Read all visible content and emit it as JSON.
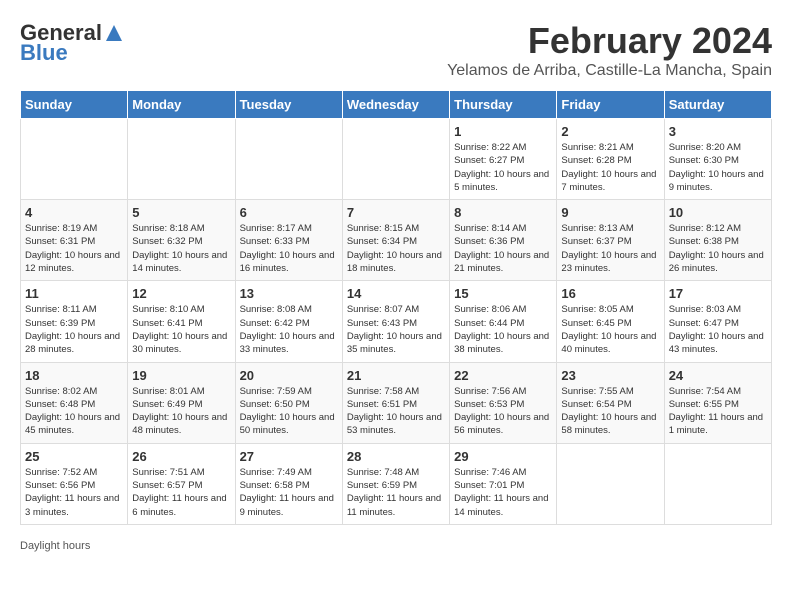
{
  "header": {
    "logo_general": "General",
    "logo_blue": "Blue",
    "month_title": "February 2024",
    "location": "Yelamos de Arriba, Castille-La Mancha, Spain"
  },
  "days_of_week": [
    "Sunday",
    "Monday",
    "Tuesday",
    "Wednesday",
    "Thursday",
    "Friday",
    "Saturday"
  ],
  "footer": {
    "daylight_hours": "Daylight hours"
  },
  "weeks": [
    {
      "days": [
        {
          "number": "",
          "info": ""
        },
        {
          "number": "",
          "info": ""
        },
        {
          "number": "",
          "info": ""
        },
        {
          "number": "",
          "info": ""
        },
        {
          "number": "1",
          "info": "Sunrise: 8:22 AM\nSunset: 6:27 PM\nDaylight: 10 hours and 5 minutes."
        },
        {
          "number": "2",
          "info": "Sunrise: 8:21 AM\nSunset: 6:28 PM\nDaylight: 10 hours and 7 minutes."
        },
        {
          "number": "3",
          "info": "Sunrise: 8:20 AM\nSunset: 6:30 PM\nDaylight: 10 hours and 9 minutes."
        }
      ]
    },
    {
      "days": [
        {
          "number": "4",
          "info": "Sunrise: 8:19 AM\nSunset: 6:31 PM\nDaylight: 10 hours and 12 minutes."
        },
        {
          "number": "5",
          "info": "Sunrise: 8:18 AM\nSunset: 6:32 PM\nDaylight: 10 hours and 14 minutes."
        },
        {
          "number": "6",
          "info": "Sunrise: 8:17 AM\nSunset: 6:33 PM\nDaylight: 10 hours and 16 minutes."
        },
        {
          "number": "7",
          "info": "Sunrise: 8:15 AM\nSunset: 6:34 PM\nDaylight: 10 hours and 18 minutes."
        },
        {
          "number": "8",
          "info": "Sunrise: 8:14 AM\nSunset: 6:36 PM\nDaylight: 10 hours and 21 minutes."
        },
        {
          "number": "9",
          "info": "Sunrise: 8:13 AM\nSunset: 6:37 PM\nDaylight: 10 hours and 23 minutes."
        },
        {
          "number": "10",
          "info": "Sunrise: 8:12 AM\nSunset: 6:38 PM\nDaylight: 10 hours and 26 minutes."
        }
      ]
    },
    {
      "days": [
        {
          "number": "11",
          "info": "Sunrise: 8:11 AM\nSunset: 6:39 PM\nDaylight: 10 hours and 28 minutes."
        },
        {
          "number": "12",
          "info": "Sunrise: 8:10 AM\nSunset: 6:41 PM\nDaylight: 10 hours and 30 minutes."
        },
        {
          "number": "13",
          "info": "Sunrise: 8:08 AM\nSunset: 6:42 PM\nDaylight: 10 hours and 33 minutes."
        },
        {
          "number": "14",
          "info": "Sunrise: 8:07 AM\nSunset: 6:43 PM\nDaylight: 10 hours and 35 minutes."
        },
        {
          "number": "15",
          "info": "Sunrise: 8:06 AM\nSunset: 6:44 PM\nDaylight: 10 hours and 38 minutes."
        },
        {
          "number": "16",
          "info": "Sunrise: 8:05 AM\nSunset: 6:45 PM\nDaylight: 10 hours and 40 minutes."
        },
        {
          "number": "17",
          "info": "Sunrise: 8:03 AM\nSunset: 6:47 PM\nDaylight: 10 hours and 43 minutes."
        }
      ]
    },
    {
      "days": [
        {
          "number": "18",
          "info": "Sunrise: 8:02 AM\nSunset: 6:48 PM\nDaylight: 10 hours and 45 minutes."
        },
        {
          "number": "19",
          "info": "Sunrise: 8:01 AM\nSunset: 6:49 PM\nDaylight: 10 hours and 48 minutes."
        },
        {
          "number": "20",
          "info": "Sunrise: 7:59 AM\nSunset: 6:50 PM\nDaylight: 10 hours and 50 minutes."
        },
        {
          "number": "21",
          "info": "Sunrise: 7:58 AM\nSunset: 6:51 PM\nDaylight: 10 hours and 53 minutes."
        },
        {
          "number": "22",
          "info": "Sunrise: 7:56 AM\nSunset: 6:53 PM\nDaylight: 10 hours and 56 minutes."
        },
        {
          "number": "23",
          "info": "Sunrise: 7:55 AM\nSunset: 6:54 PM\nDaylight: 10 hours and 58 minutes."
        },
        {
          "number": "24",
          "info": "Sunrise: 7:54 AM\nSunset: 6:55 PM\nDaylight: 11 hours and 1 minute."
        }
      ]
    },
    {
      "days": [
        {
          "number": "25",
          "info": "Sunrise: 7:52 AM\nSunset: 6:56 PM\nDaylight: 11 hours and 3 minutes."
        },
        {
          "number": "26",
          "info": "Sunrise: 7:51 AM\nSunset: 6:57 PM\nDaylight: 11 hours and 6 minutes."
        },
        {
          "number": "27",
          "info": "Sunrise: 7:49 AM\nSunset: 6:58 PM\nDaylight: 11 hours and 9 minutes."
        },
        {
          "number": "28",
          "info": "Sunrise: 7:48 AM\nSunset: 6:59 PM\nDaylight: 11 hours and 11 minutes."
        },
        {
          "number": "29",
          "info": "Sunrise: 7:46 AM\nSunset: 7:01 PM\nDaylight: 11 hours and 14 minutes."
        },
        {
          "number": "",
          "info": ""
        },
        {
          "number": "",
          "info": ""
        }
      ]
    }
  ]
}
